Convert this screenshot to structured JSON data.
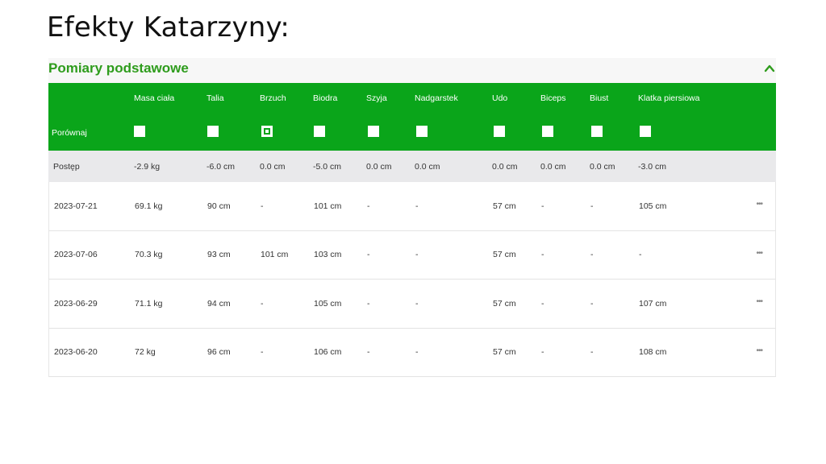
{
  "slide": {
    "title": "Efekty Katarzyny:"
  },
  "panel": {
    "title": "Pomiary podstawowe",
    "accent_color": "#0aa51a",
    "title_color": "#2e9c1c",
    "collapse_icon": "chevron-up-icon"
  },
  "table": {
    "columns": [
      "Masa ciała",
      "Talia",
      "Brzuch",
      "Biodra",
      "Szyja",
      "Nadgarstek",
      "Udo",
      "Biceps",
      "Biust",
      "Klatka piersiowa"
    ],
    "compare_label": "Porównaj",
    "compare_checked": [
      false,
      false,
      true,
      false,
      false,
      false,
      false,
      false,
      false,
      false
    ],
    "progress": {
      "label": "Postęp",
      "values": [
        "-2.9 kg",
        "-6.0 cm",
        "0.0 cm",
        "-5.0 cm",
        "0.0 cm",
        "0.0 cm",
        "0.0 cm",
        "0.0 cm",
        "0.0 cm",
        "-3.0 cm"
      ]
    },
    "rows": [
      {
        "date": "2023-07-21",
        "values": [
          "69.1 kg",
          "90 cm",
          "-",
          "101 cm",
          "-",
          "-",
          "57 cm",
          "-",
          "-",
          "105 cm"
        ],
        "menu": "•••"
      },
      {
        "date": "2023-07-06",
        "values": [
          "70.3 kg",
          "93 cm",
          "101 cm",
          "103 cm",
          "-",
          "-",
          "57 cm",
          "-",
          "-",
          "-"
        ],
        "menu": "•••"
      },
      {
        "date": "2023-06-29",
        "values": [
          "71.1 kg",
          "94 cm",
          "-",
          "105 cm",
          "-",
          "-",
          "57 cm",
          "-",
          "-",
          "107 cm"
        ],
        "menu": "•••"
      },
      {
        "date": "2023-06-20",
        "values": [
          "72 kg",
          "96 cm",
          "-",
          "106 cm",
          "-",
          "-",
          "57 cm",
          "-",
          "-",
          "108 cm"
        ],
        "menu": "•••"
      }
    ]
  }
}
